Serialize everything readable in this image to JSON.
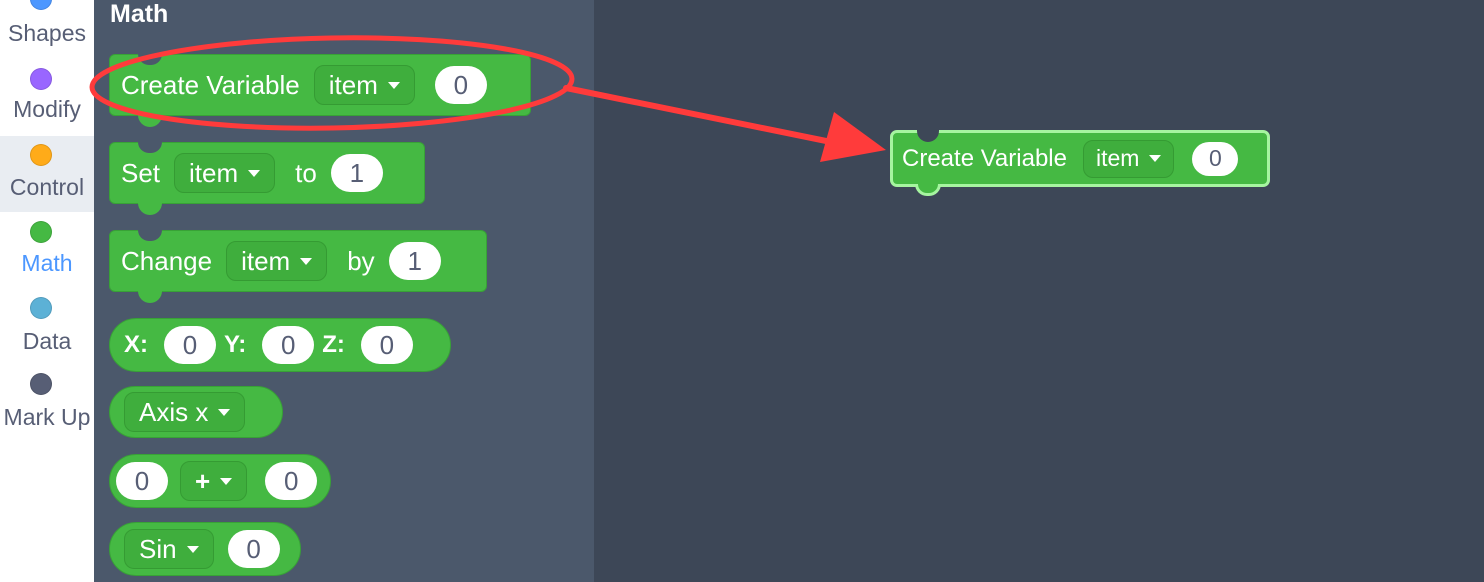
{
  "sidebar": {
    "items": [
      {
        "label": "Shapes",
        "color": "#4c97ff"
      },
      {
        "label": "Modify",
        "color": "#9966ff"
      },
      {
        "label": "Control",
        "color": "#ffab19"
      },
      {
        "label": "Math",
        "color": "#45b943"
      },
      {
        "label": "Data",
        "color": "#5cb1d6"
      },
      {
        "label": "Mark Up",
        "color": "#575e75"
      }
    ]
  },
  "flyout": {
    "title": "Math",
    "blocks": {
      "create_variable": {
        "label": "Create Variable",
        "var": "item",
        "value": "0"
      },
      "set": {
        "label": "Set",
        "var": "item",
        "to": "to",
        "value": "1"
      },
      "change": {
        "label": "Change",
        "var": "item",
        "by": "by",
        "value": "1"
      },
      "xyz": {
        "x_label": "X:",
        "x": "0",
        "y_label": "Y:",
        "y": "0",
        "z_label": "Z:",
        "z": "0"
      },
      "axis": {
        "value": "Axis x"
      },
      "arith": {
        "a": "0",
        "op": "+",
        "b": "0"
      },
      "trig": {
        "fn": "Sin",
        "value": "0"
      }
    }
  },
  "workspace": {
    "block": {
      "label": "Create Variable",
      "var": "item",
      "value": "0"
    }
  },
  "colors": {
    "block_green": "#45b943",
    "annotation_red": "#ff3b3b",
    "flyout_bg": "#4b586b",
    "workspace_bg": "#3d4757"
  }
}
